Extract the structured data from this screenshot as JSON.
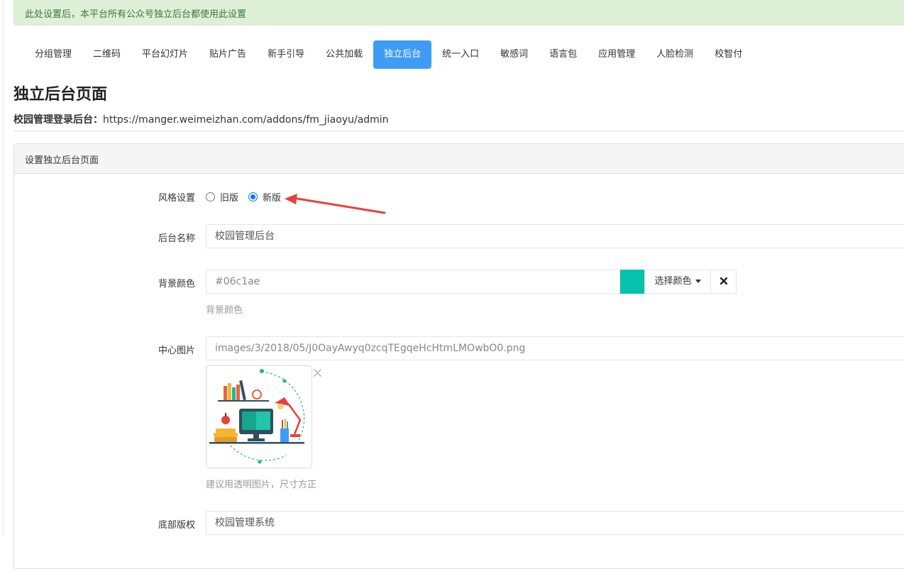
{
  "notice": "此处设置后，本平台所有公众号独立后台都使用此设置",
  "tabs": [
    {
      "label": "分组管理",
      "active": false
    },
    {
      "label": "二维码",
      "active": false
    },
    {
      "label": "平台幻灯片",
      "active": false
    },
    {
      "label": "贴片广告",
      "active": false
    },
    {
      "label": "新手引导",
      "active": false
    },
    {
      "label": "公共加载",
      "active": false
    },
    {
      "label": "独立后台",
      "active": true
    },
    {
      "label": "统一入口",
      "active": false
    },
    {
      "label": "敏感词",
      "active": false
    },
    {
      "label": "语言包",
      "active": false
    },
    {
      "label": "应用管理",
      "active": false
    },
    {
      "label": "人脸检测",
      "active": false
    },
    {
      "label": "校智付",
      "active": false
    }
  ],
  "page_title": "独立后台页面",
  "login": {
    "label": "校园管理登录后台：",
    "url": "https://manger.weimeizhan.com/addons/fm_jiaoyu/admin"
  },
  "panel": {
    "heading": "设置独立后台页面",
    "style": {
      "label": "风格设置",
      "options": [
        {
          "label": "旧版",
          "checked": false
        },
        {
          "label": "新版",
          "checked": true
        }
      ]
    },
    "backend_name": {
      "label": "后台名称",
      "value": "校园管理后台"
    },
    "bg_color": {
      "label": "背景颜色",
      "value": "#06c1ae",
      "swatch": "#06c1ae",
      "pick_label": "选择颜色",
      "clear_icon": "close-icon",
      "help": "背景颜色"
    },
    "center_image": {
      "label": "中心图片",
      "value": "images/3/2018/05/J0OayAwyq0zcqTEgqeHcHtmLMOwbO0.png",
      "remove_icon": "close-icon",
      "help": "建议用透明图片，尺寸方正"
    },
    "footer": {
      "label": "底部版权",
      "value": "校园管理系统"
    }
  },
  "colors": {
    "accent": "#3f9cf5",
    "notice_bg": "#dff0d8",
    "notice_text": "#3c763d",
    "annotation_arrow": "#e8413a"
  }
}
